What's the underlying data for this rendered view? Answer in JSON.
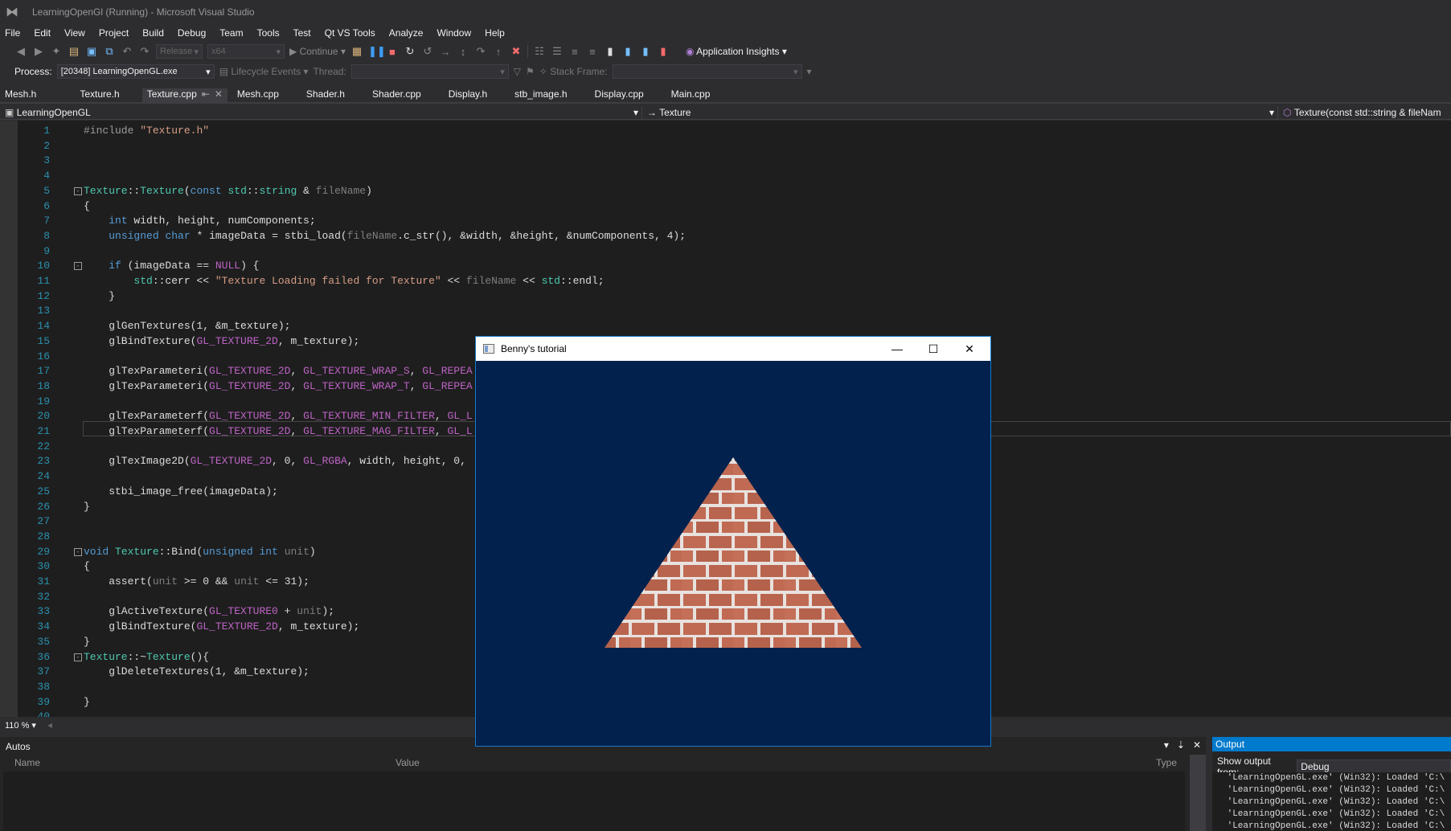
{
  "window": {
    "title": "LearningOpenGl (Running) - Microsoft Visual Studio"
  },
  "menu": [
    "File",
    "Edit",
    "View",
    "Project",
    "Build",
    "Debug",
    "Team",
    "Tools",
    "Test",
    "Qt VS Tools",
    "Analyze",
    "Window",
    "Help"
  ],
  "toolbar": {
    "config": "Release",
    "platform": "x64",
    "continue_label": "Continue",
    "app_insights": "Application Insights"
  },
  "process_bar": {
    "process_label": "Process:",
    "process_value": "[20348] LearningOpenGL.exe",
    "lifecycle": "Lifecycle Events",
    "thread_label": "Thread:",
    "stack_frame_label": "Stack Frame:"
  },
  "tabs": [
    "Mesh.h",
    "Texture.h",
    "Texture.cpp",
    "Mesh.cpp",
    "Shader.h",
    "Shader.cpp",
    "Display.h",
    "stb_image.h",
    "Display.cpp",
    "Main.cpp"
  ],
  "active_tab": "Texture.cpp",
  "nav": {
    "project": "LearningOpenGL",
    "scope": "Texture",
    "member": "Texture(const std::string & fileNam"
  },
  "code_lines": [
    "#include \"Texture.h\"",
    "",
    "",
    "",
    "Texture::Texture(const std::string & fileName)",
    "{",
    "    int width, height, numComponents;",
    "    unsigned char * imageData = stbi_load(fileName.c_str(), &width, &height, &numComponents, 4);",
    "",
    "    if (imageData == NULL) {",
    "        std::cerr << \"Texture Loading failed for Texture\" << fileName << std::endl;",
    "    }",
    "",
    "    glGenTextures(1, &m_texture);",
    "    glBindTexture(GL_TEXTURE_2D, m_texture);",
    "",
    "    glTexParameteri(GL_TEXTURE_2D, GL_TEXTURE_WRAP_S, GL_REPEA",
    "    glTexParameteri(GL_TEXTURE_2D, GL_TEXTURE_WRAP_T, GL_REPEA",
    "",
    "    glTexParameterf(GL_TEXTURE_2D, GL_TEXTURE_MIN_FILTER, GL_L",
    "    glTexParameterf(GL_TEXTURE_2D, GL_TEXTURE_MAG_FILTER, GL_L",
    "",
    "    glTexImage2D(GL_TEXTURE_2D, 0, GL_RGBA, width, height, 0,",
    "",
    "    stbi_image_free(imageData);",
    "}",
    "",
    "",
    "void Texture::Bind(unsigned int unit)",
    "{",
    "    assert(unit >= 0 && unit <= 31);",
    "",
    "    glActiveTexture(GL_TEXTURE0 + unit);",
    "    glBindTexture(GL_TEXTURE_2D, m_texture);",
    "}",
    "Texture::~Texture(){",
    "    glDeleteTextures(1, &m_texture);",
    "",
    "}",
    ""
  ],
  "zoom": "110 %",
  "autos": {
    "title": "Autos",
    "columns": [
      "Name",
      "Value",
      "Type"
    ]
  },
  "output": {
    "title": "Output",
    "show_label": "Show output from:",
    "source": "Debug",
    "lines": [
      " 'LearningOpenGL.exe' (Win32): Loaded 'C:\\",
      " 'LearningOpenGL.exe' (Win32): Loaded 'C:\\",
      " 'LearningOpenGL.exe' (Win32): Loaded 'C:\\",
      " 'LearningOpenGL.exe' (Win32): Loaded 'C:\\",
      " 'LearningOpenGL.exe' (Win32): Loaded 'C:\\"
    ]
  },
  "gl_window": {
    "title": "Benny's tutorial",
    "background": "#02214d",
    "brick_color": "#c06a53",
    "mortar_color": "#e8e2df"
  }
}
